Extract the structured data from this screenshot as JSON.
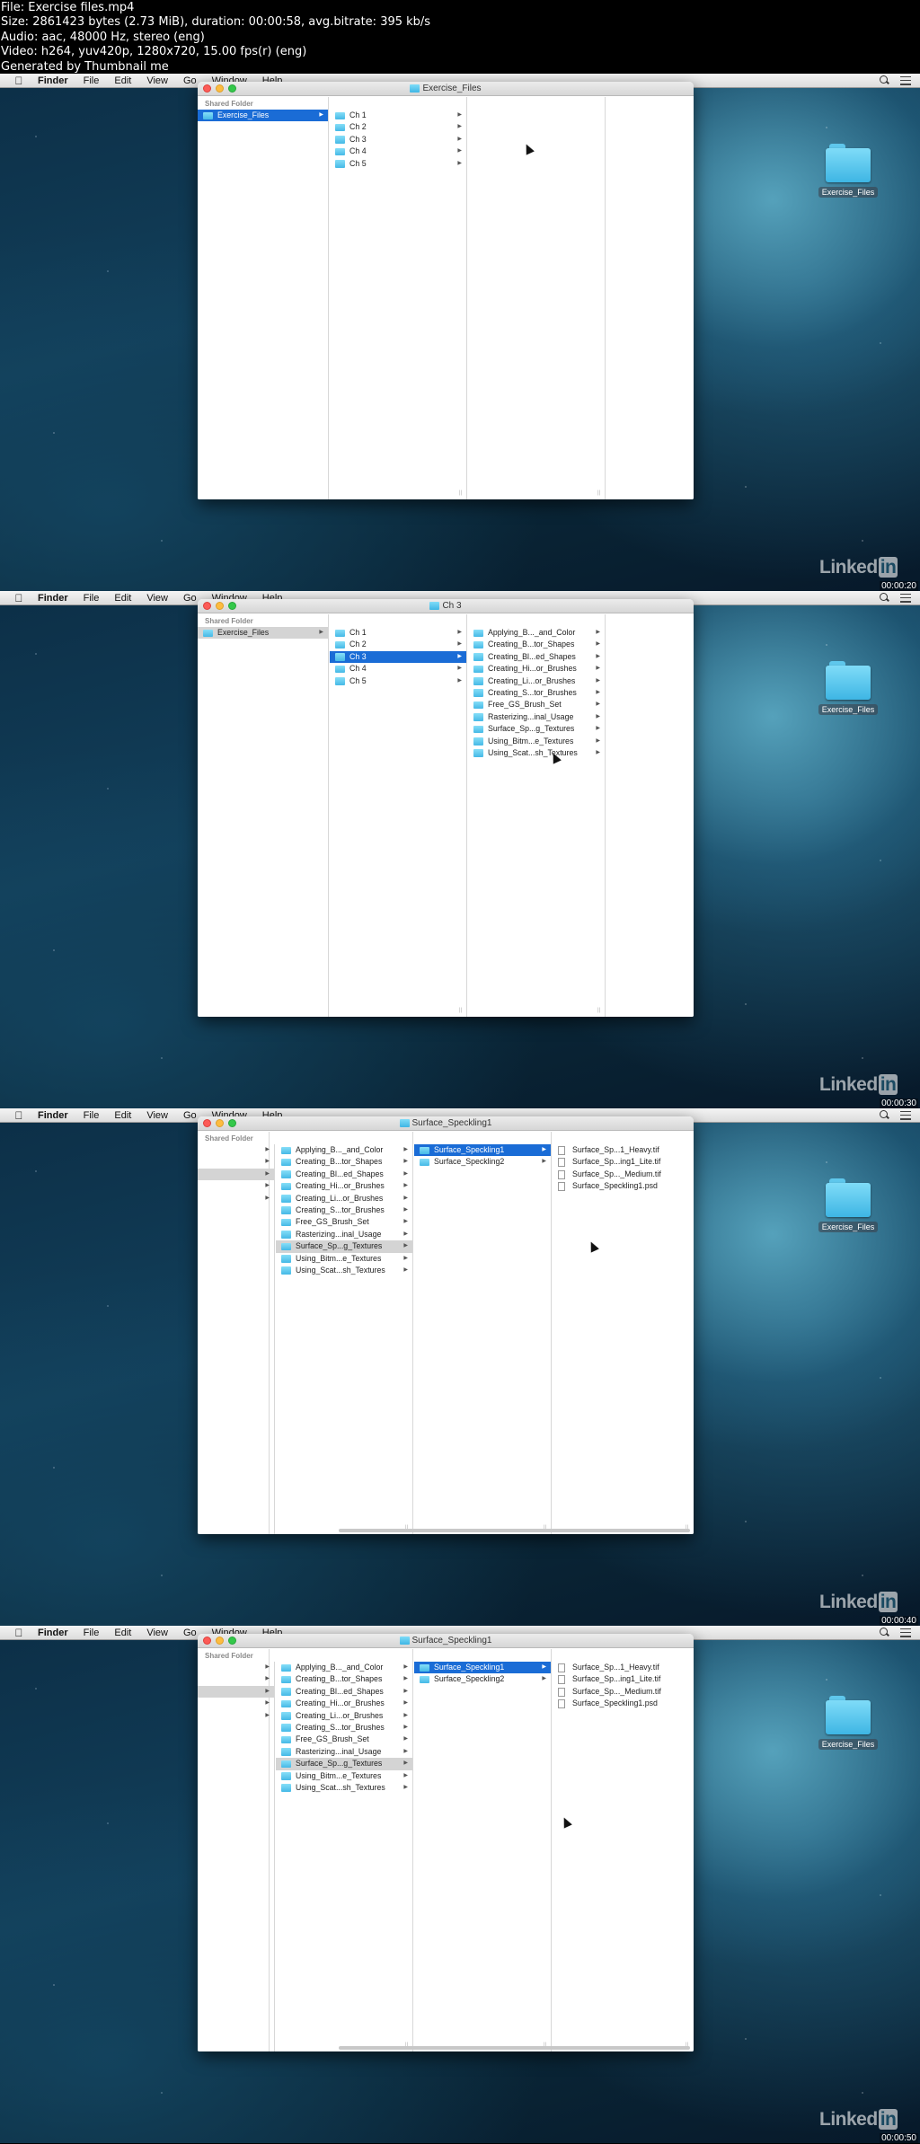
{
  "header": {
    "lines": [
      "File: Exercise files.mp4",
      "Size: 2861423 bytes (2.73 MiB), duration: 00:00:58, avg.bitrate: 395 kb/s",
      "Audio: aac, 48000 Hz, stereo (eng)",
      "Video: h264, yuv420p, 1280x720, 15.00 fps(r) (eng)",
      "Generated by Thumbnail me"
    ]
  },
  "menubar": {
    "apple": "",
    "items": [
      "Finder",
      "File",
      "Edit",
      "View",
      "Go",
      "Window",
      "Help"
    ]
  },
  "desktop": {
    "icon_label": "Exercise_Files"
  },
  "sidebar": {
    "section": "Shared Folder",
    "item": "Exercise_Files"
  },
  "chapters": [
    "Ch 1",
    "Ch 2",
    "Ch 3",
    "Ch 4",
    "Ch 5"
  ],
  "ch3_items": [
    "Applying_B..._and_Color",
    "Creating_B...tor_Shapes",
    "Creating_Bl...ed_Shapes",
    "Creating_Hi...or_Brushes",
    "Creating_Li...or_Brushes",
    "Creating_S...tor_Brushes",
    "Free_GS_Brush_Set",
    "Rasterizing...inal_Usage",
    "Surface_Sp...g_Textures",
    "Using_Bitm...e_Textures",
    "Using_Scat...sh_Textures"
  ],
  "ch3_items_short": [
    "Applying_B..._and_Color",
    "Creating_B...tor_Shapes",
    "Creating_Bl...ed_Shapes",
    "Creating_Hi...or_Brushes",
    "Creating_Li...or_Brushes",
    "Creating_S...tor_Brushes",
    "Free_GS_Brush_Set",
    "Rasterizing...inal_Usage",
    "Surface_Sp...g_Textures",
    "Using_Bitm...e_Textures",
    "Using_Scat...sh_Textures"
  ],
  "speckling_folders": [
    "Surface_Speckling1",
    "Surface_Speckling2"
  ],
  "speckling_files": [
    "Surface_Sp...1_Heavy.tif",
    "Surface_Sp...ing1_Lite.tif",
    "Surface_Sp..._Medium.tif",
    "Surface_Speckling1.psd"
  ],
  "frames": [
    {
      "title": "Exercise_Files",
      "timestamp": "00:00:20"
    },
    {
      "title": "Ch 3",
      "timestamp": "00:00:30"
    },
    {
      "title": "Surface_Speckling1",
      "timestamp": "00:00:40"
    },
    {
      "title": "Surface_Speckling1",
      "timestamp": "00:00:50"
    }
  ],
  "watermark": {
    "text": "Linked",
    "badge": "in"
  },
  "colors": {
    "selection": "#1a6cd6",
    "folder": "#45b9e6",
    "menubar": "#e6e6e6"
  }
}
